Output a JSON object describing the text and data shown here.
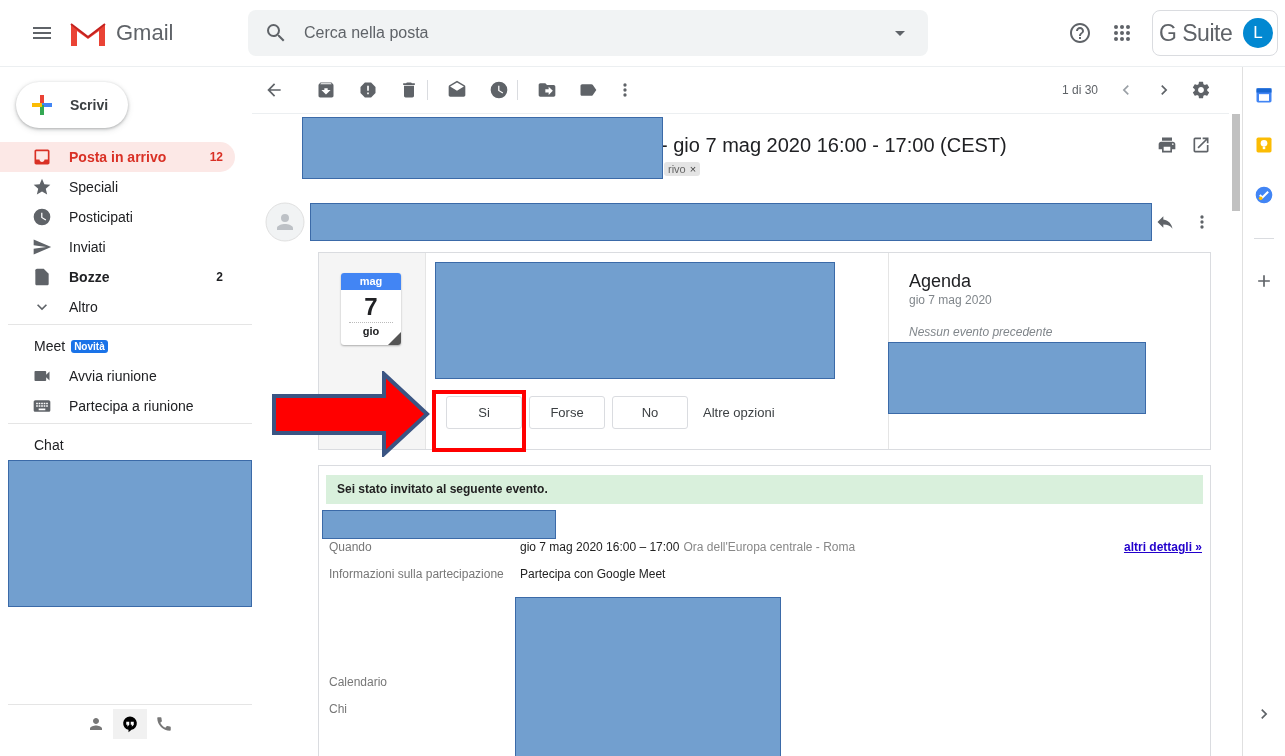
{
  "header": {
    "app_name": "Gmail",
    "search": {
      "placeholder": "Cerca nella posta"
    },
    "brand": "G Suite",
    "avatar_initial": "L"
  },
  "compose": {
    "label": "Scrivi"
  },
  "nav": [
    {
      "label": "Posta in arrivo",
      "count": "12",
      "selected": true,
      "bold": true
    },
    {
      "label": "Speciali",
      "selected": false,
      "bold": false
    },
    {
      "label": "Posticipati",
      "selected": false,
      "bold": false
    },
    {
      "label": "Inviati",
      "selected": false,
      "bold": false
    },
    {
      "label": "Bozze",
      "count": "2",
      "selected": false,
      "bold": true
    },
    {
      "label": "Altro",
      "selected": false,
      "bold": false
    }
  ],
  "meet": {
    "title": "Meet",
    "badge": "Novità",
    "items": [
      {
        "label": "Avvia riunione"
      },
      {
        "label": "Partecipa a riunione"
      }
    ]
  },
  "chat": {
    "title": "Chat"
  },
  "chat_tabs": [
    {
      "selected": false
    },
    {
      "selected": true
    },
    {
      "selected": false
    }
  ],
  "toolbar": {
    "pagination": "1 di 30"
  },
  "message": {
    "subject": "- gio 7 mag 2020 16:00 - 17:00 (CEST)",
    "label_chip": "rivo",
    "chip_close": "×"
  },
  "invite": {
    "month": "mag",
    "day": "7",
    "weekday": "gio",
    "rsvp": [
      {
        "label": "Si"
      },
      {
        "label": "Forse"
      },
      {
        "label": "No"
      }
    ],
    "more": "Altre opzioni",
    "agenda": {
      "title": "Agenda",
      "date": "gio 7 mag 2020",
      "empty": "Nessun evento precedente"
    }
  },
  "details": {
    "banner": "Sei stato invitato al seguente evento.",
    "link": "altri dettagli »",
    "rows": [
      {
        "label": "Quando",
        "value": "gio 7 mag 2020 16:00 – 17:00",
        "note": "Ora dell'Europa centrale - Roma"
      },
      {
        "label": "Informazioni sulla partecipazione",
        "value": "Partecipa con Google Meet"
      },
      {
        "label": "Calendario"
      },
      {
        "label": "Chi"
      }
    ]
  }
}
